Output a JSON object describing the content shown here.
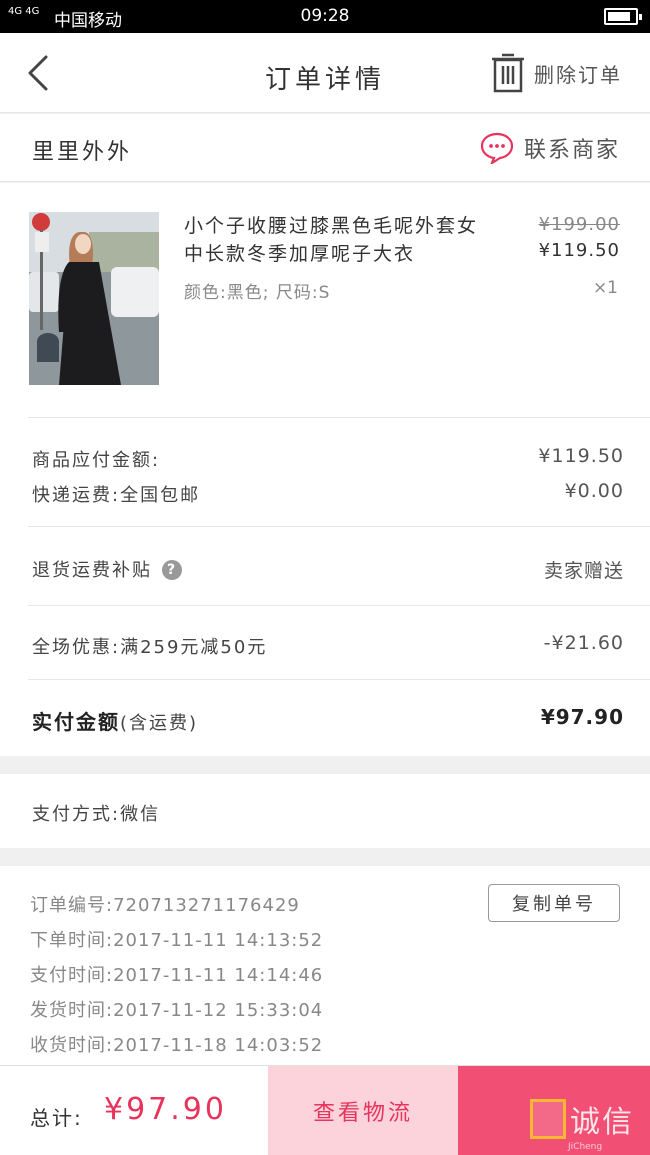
{
  "status_bar": {
    "signal": "4G 4G",
    "carrier": "中国移动",
    "time": "09:28"
  },
  "header": {
    "title": "订单详情",
    "delete_label": "删除订单"
  },
  "shop": {
    "name": "里里外外",
    "contact_label": "联系商家"
  },
  "product": {
    "title": "小个子收腰过膝黑色毛呢外套女中长款冬季加厚呢子大衣",
    "spec": "颜色:黑色; 尺码:S",
    "original_price": "¥199.00",
    "price": "¥119.50",
    "quantity": "×1"
  },
  "costs": {
    "goods_label": "商品应付金额:",
    "goods_value": "¥119.50",
    "shipping_label": "快递运费:全国包邮",
    "shipping_value": "¥0.00",
    "return_label": "退货运费补贴",
    "return_value": "卖家赠送",
    "discount_label": "全场优惠:满259元减50元",
    "discount_value": "-¥21.60",
    "paid_label": "实付金额",
    "paid_note": "(含运费)",
    "paid_value": "¥97.90"
  },
  "payment": {
    "method_label": "支付方式:微信"
  },
  "order_info": {
    "order_no": "订单编号:720713271176429",
    "order_time": "下单时间:2017-11-11 14:13:52",
    "pay_time": "支付时间:2017-11-11 14:14:46",
    "ship_time": "发货时间:2017-11-12 15:33:04",
    "receive_time": "收货时间:2017-11-18 14:03:52",
    "copy_label": "复制单号"
  },
  "bottom": {
    "total_label": "总计:",
    "total_value": "¥97.90",
    "logistics_label": "查看物流"
  },
  "watermark": {
    "text": "诚信",
    "sub": "JiCheng"
  },
  "colors": {
    "accent": "#e8335c",
    "accent_light": "#fcd3db",
    "confirm": "#f14f74"
  }
}
